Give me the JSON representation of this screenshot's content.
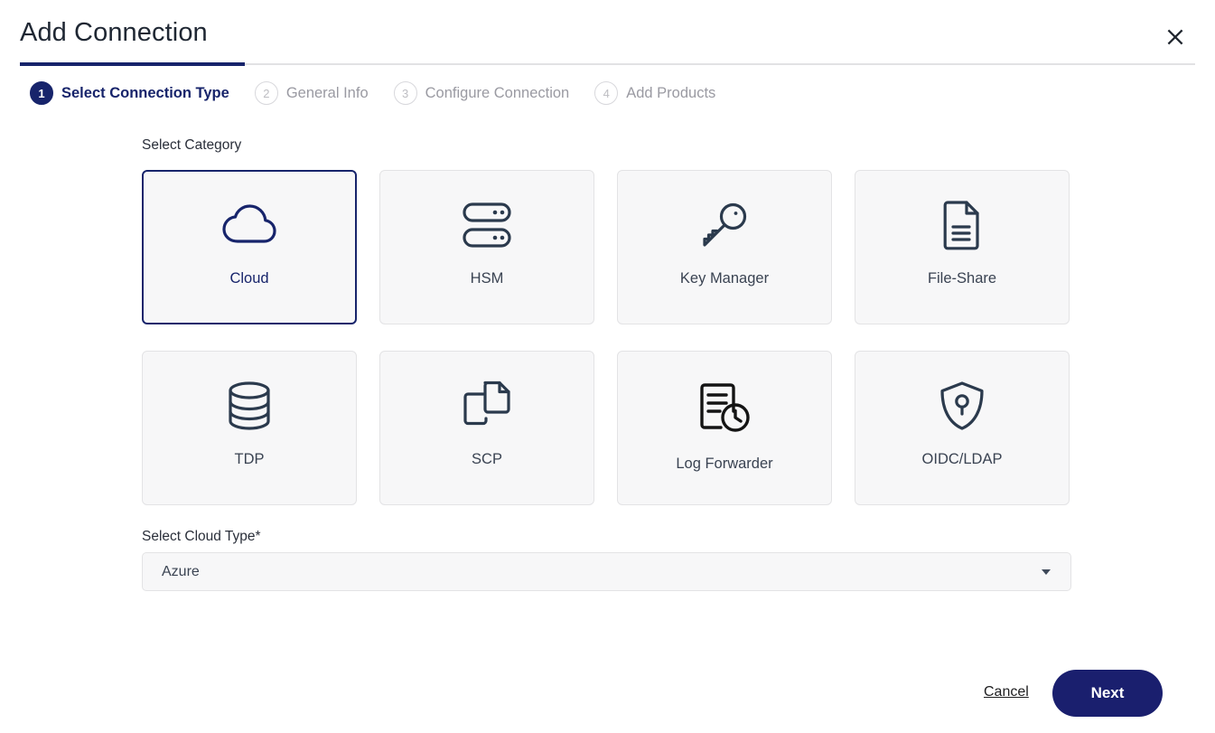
{
  "dialog": {
    "title": "Add Connection",
    "close_icon": "close-icon"
  },
  "stepper": {
    "steps": [
      {
        "number": "1",
        "label": "Select Connection Type",
        "state": "active"
      },
      {
        "number": "2",
        "label": "General Info",
        "state": "inactive"
      },
      {
        "number": "3",
        "label": "Configure Connection",
        "state": "inactive"
      },
      {
        "number": "4",
        "label": "Add Products",
        "state": "inactive"
      }
    ]
  },
  "main": {
    "category_label": "Select Category",
    "categories": [
      {
        "label": "Cloud",
        "icon": "cloud-icon",
        "selected": true
      },
      {
        "label": "HSM",
        "icon": "server-rack-icon",
        "selected": false
      },
      {
        "label": "Key Manager",
        "icon": "key-icon",
        "selected": false
      },
      {
        "label": "File-Share",
        "icon": "document-icon",
        "selected": false
      },
      {
        "label": "TDP",
        "icon": "database-icon",
        "selected": false
      },
      {
        "label": "SCP",
        "icon": "copy-files-icon",
        "selected": false
      },
      {
        "label": "Log Forwarder",
        "icon": "log-clock-icon",
        "selected": false
      },
      {
        "label": "OIDC/LDAP",
        "icon": "shield-key-icon",
        "selected": false
      }
    ],
    "cloud_type_label": "Select Cloud Type*",
    "cloud_type_value": "Azure",
    "cloud_type_caret": "chevron-down-icon"
  },
  "footer": {
    "cancel_label": "Cancel",
    "next_label": "Next"
  },
  "colors": {
    "accent_navy": "#17246b",
    "button_navy": "#1a1f6e",
    "icon_slate": "#2b3a4d",
    "card_bg": "#f7f7f8",
    "card_border": "#e3e3e5",
    "muted_text": "#9a9aa2"
  }
}
